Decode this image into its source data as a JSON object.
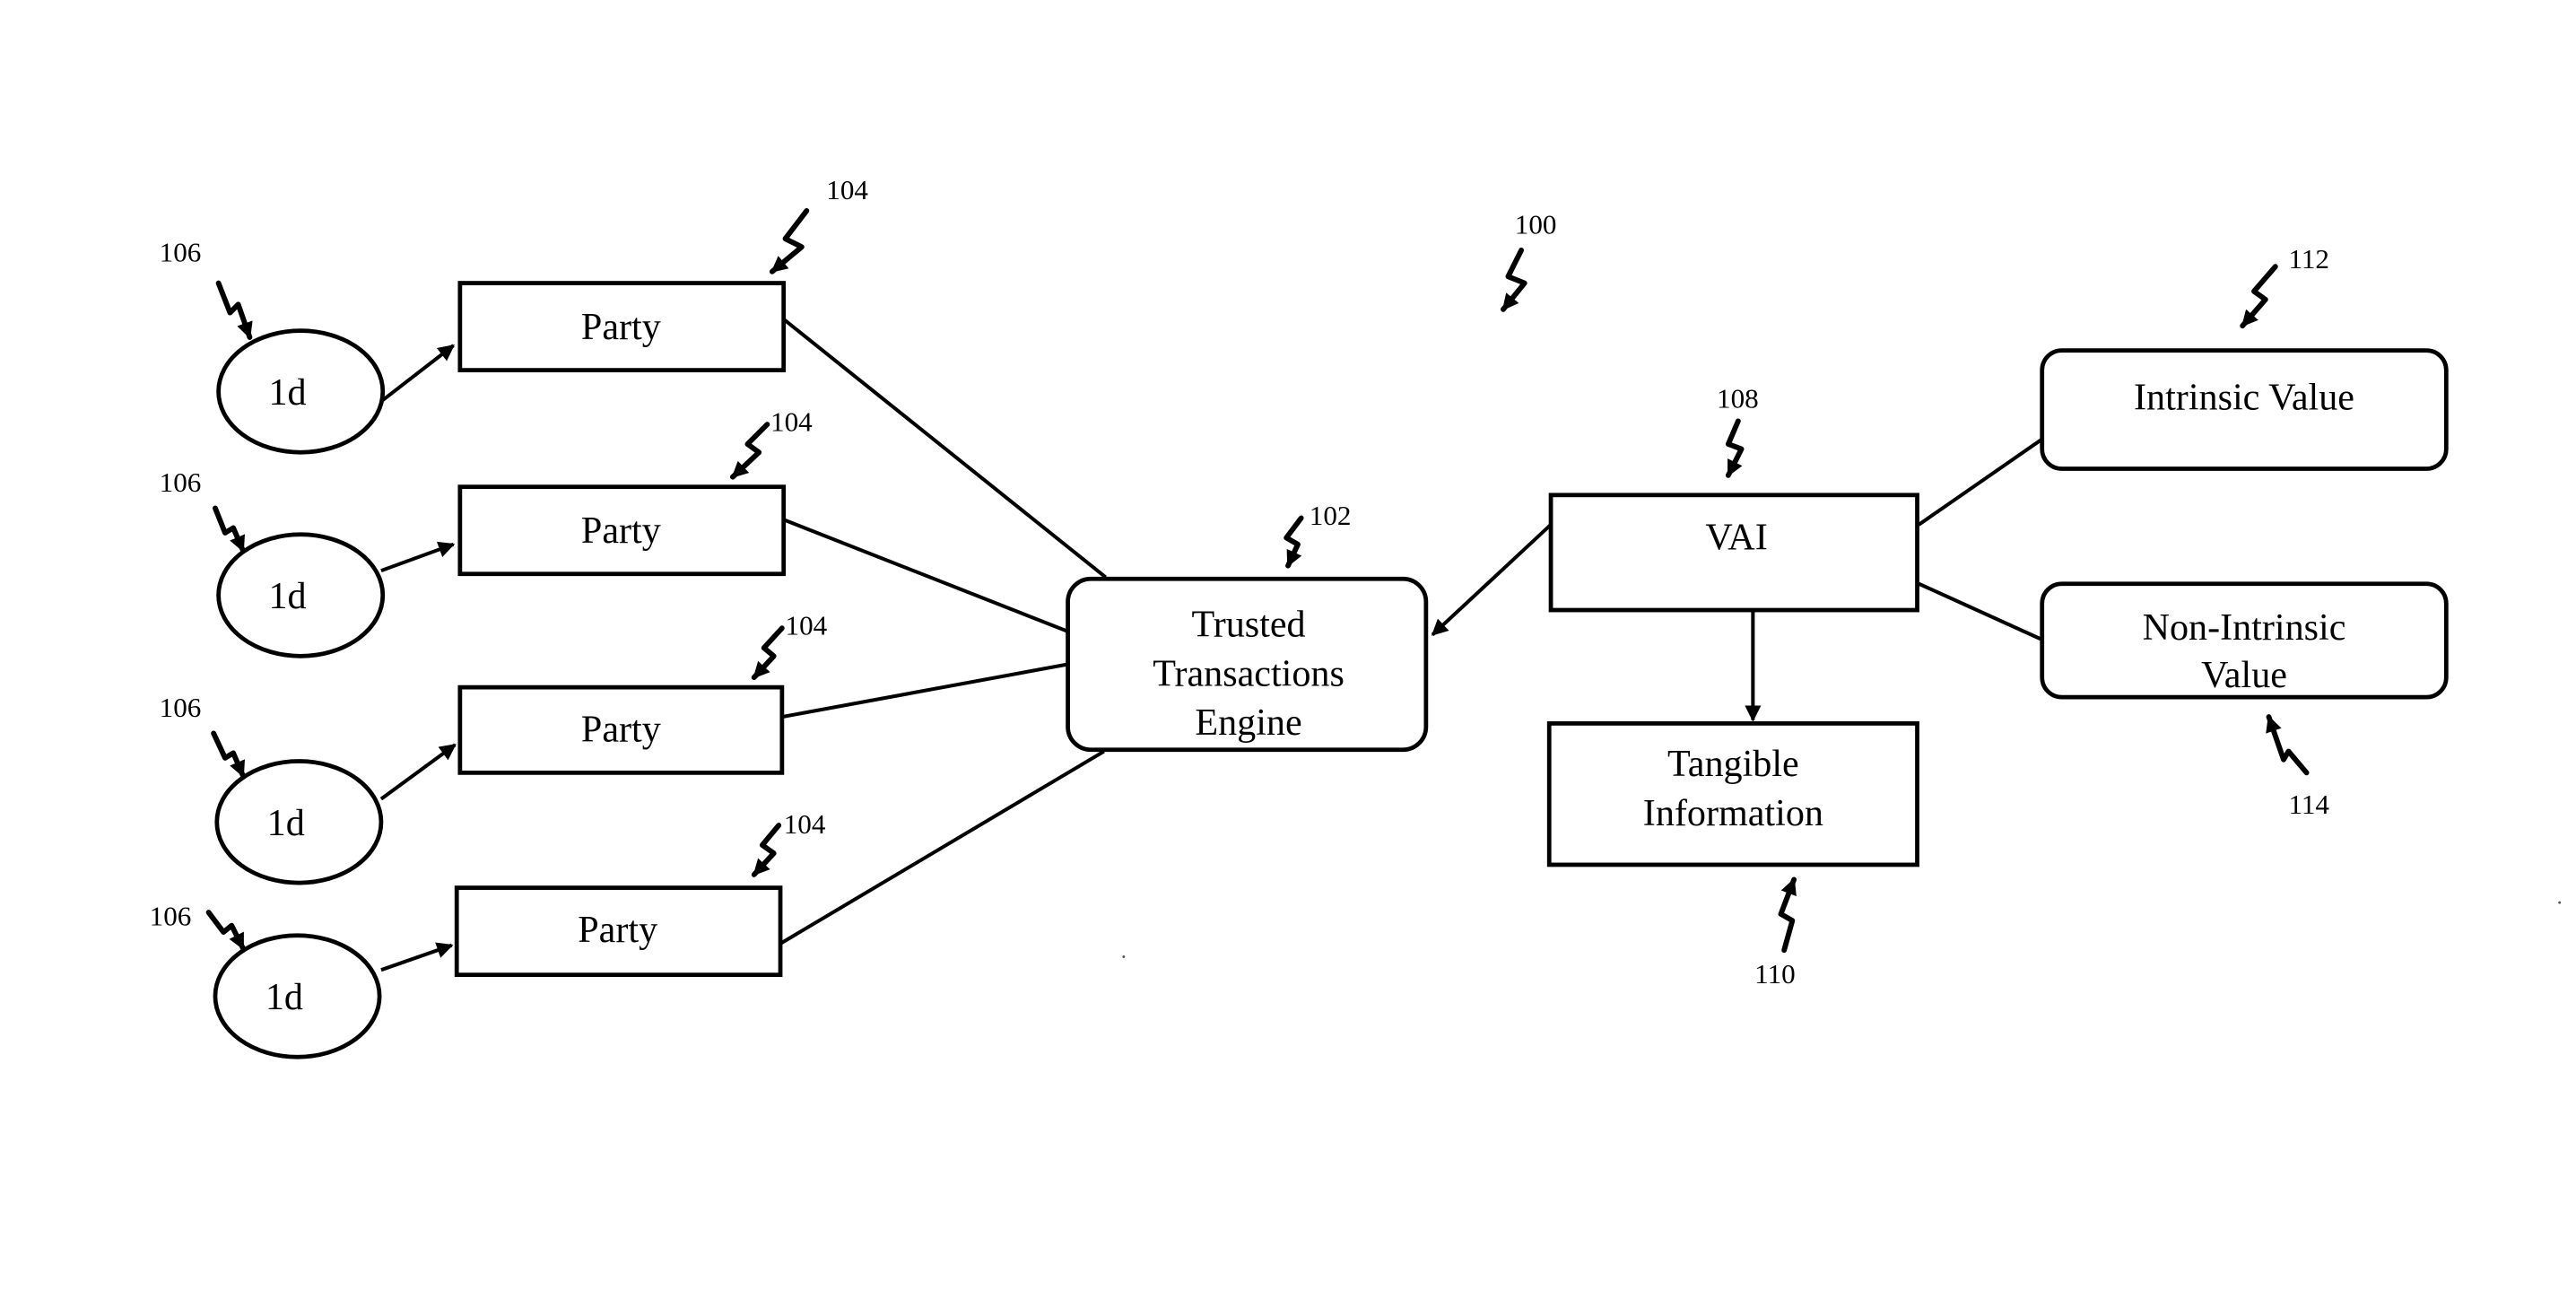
{
  "figure": {
    "reference": "100",
    "nodes": {
      "ids": [
        {
          "label": "1d",
          "ref": "106"
        },
        {
          "label": "1d",
          "ref": "106"
        },
        {
          "label": "1d",
          "ref": "106"
        },
        {
          "label": "1d",
          "ref": "106"
        }
      ],
      "parties": [
        {
          "label": "Party",
          "ref": "104"
        },
        {
          "label": "Party",
          "ref": "104"
        },
        {
          "label": "Party",
          "ref": "104"
        },
        {
          "label": "Party",
          "ref": "104"
        }
      ],
      "engine": {
        "lines": [
          "Trusted",
          "Transactions",
          "Engine"
        ],
        "ref": "102"
      },
      "vai": {
        "label": "VAI",
        "ref": "108"
      },
      "tangible": {
        "lines": [
          "Tangible",
          "Information"
        ],
        "ref": "110"
      },
      "intrinsic": {
        "label": "Intrinsic Value",
        "ref": "112"
      },
      "non_intrinsic": {
        "lines": [
          "Non-Intrinsic",
          "Value"
        ],
        "ref": "114"
      }
    },
    "edges": [
      {
        "from": "ids.0",
        "to": "parties.0",
        "arrow": true
      },
      {
        "from": "ids.1",
        "to": "parties.1",
        "arrow": true
      },
      {
        "from": "ids.2",
        "to": "parties.2",
        "arrow": true
      },
      {
        "from": "ids.3",
        "to": "parties.3",
        "arrow": true
      },
      {
        "from": "parties.0",
        "to": "engine",
        "arrow": false
      },
      {
        "from": "parties.1",
        "to": "engine",
        "arrow": false
      },
      {
        "from": "parties.2",
        "to": "engine",
        "arrow": false
      },
      {
        "from": "parties.3",
        "to": "engine",
        "arrow": false
      },
      {
        "from": "vai",
        "to": "engine",
        "arrow": true
      },
      {
        "from": "vai",
        "to": "tangible",
        "arrow": true
      },
      {
        "from": "vai",
        "to": "intrinsic",
        "arrow": false
      },
      {
        "from": "vai",
        "to": "non_intrinsic",
        "arrow": false
      }
    ]
  }
}
